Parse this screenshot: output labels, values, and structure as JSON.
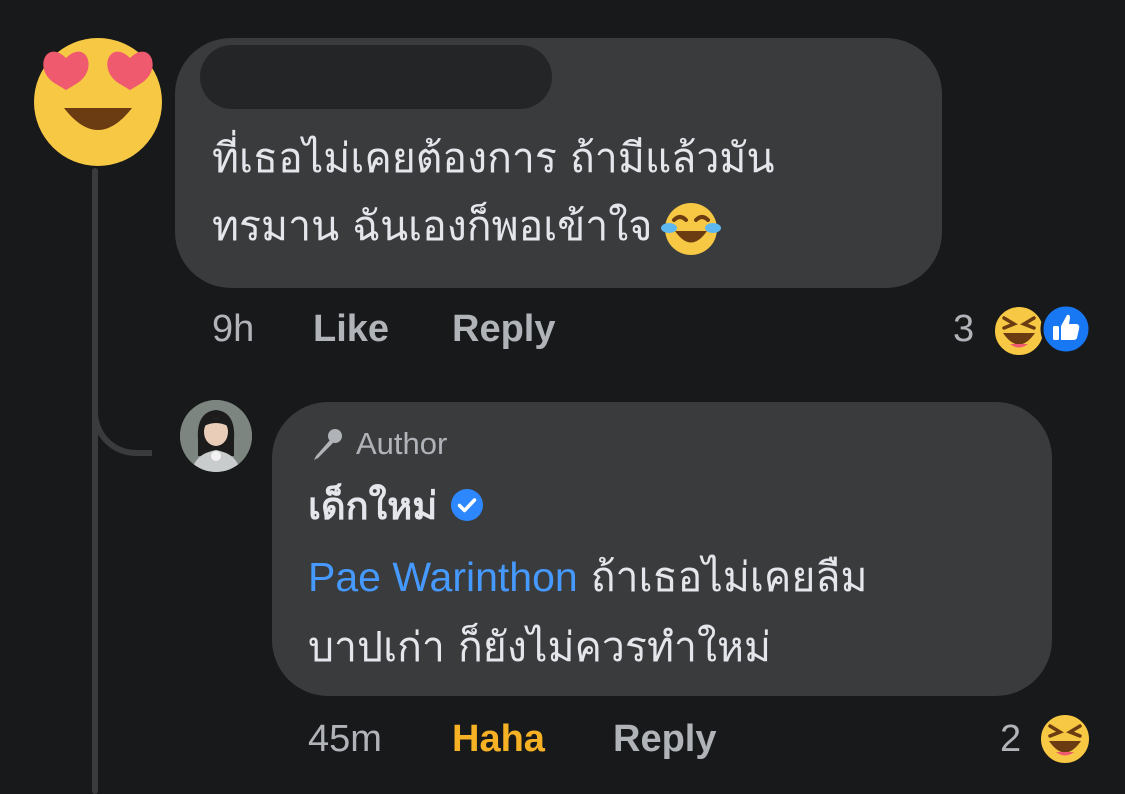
{
  "comment1": {
    "text_line1": "ที่เธอไม่เคยต้องการ ถ้ามีแล้วมัน",
    "text_line2": "ทรมาน ฉันเองก็พอเข้าใจ",
    "time": "9h",
    "like_label": "Like",
    "reply_label": "Reply",
    "reaction_count": "3",
    "reaction_icons": [
      "laughing-emoji-icon",
      "like-thumb-icon"
    ],
    "avatar_icon": "heart-eyes-emoji-icon",
    "inline_emoji": "tears-of-joy-emoji-icon"
  },
  "reply": {
    "badge_label": "Author",
    "badge_icon": "microphone-icon",
    "name": "เด็กใหม่",
    "verified_icon": "verified-badge-icon",
    "mention": "Pae Warinthon",
    "text_rest": " ถ้าเธอไม่เคยลืม",
    "text_line2": "บาปเก่า ก็ยังไม่ควรทำใหม่",
    "time": "45m",
    "haha_label": "Haha",
    "reply_label": "Reply",
    "reaction_count": "2",
    "reaction_icons": [
      "laughing-emoji-icon"
    ]
  },
  "colors": {
    "background": "#18191a",
    "bubble": "#3a3b3c",
    "text": "#e4e6eb",
    "muted": "#b0b3b8",
    "mention": "#4599ff",
    "haha": "#f7b125",
    "verified": "#2d88ff"
  }
}
